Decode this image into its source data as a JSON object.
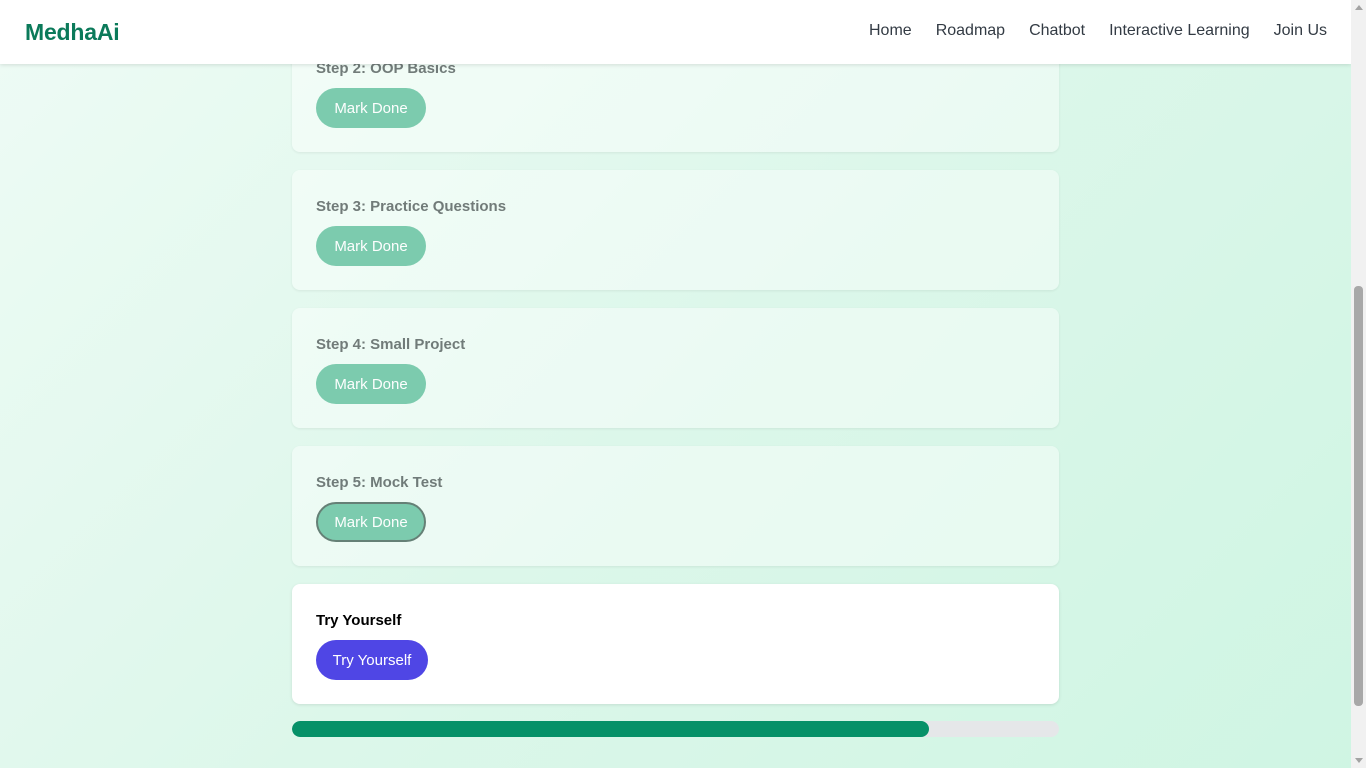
{
  "nav": {
    "brand": "MedhaAi",
    "links": [
      "Home",
      "Roadmap",
      "Chatbot",
      "Interactive Learning",
      "Join Us"
    ]
  },
  "steps": [
    {
      "title": "Step 2: OOP Basics",
      "button": "Mark Done"
    },
    {
      "title": "Step 3: Practice Questions",
      "button": "Mark Done"
    },
    {
      "title": "Step 4: Small Project",
      "button": "Mark Done"
    },
    {
      "title": "Step 5: Mock Test",
      "button": "Mark Done"
    }
  ],
  "try_section": {
    "title": "Try Yourself",
    "button": "Try Yourself"
  },
  "progress": {
    "fraction": 0.83
  },
  "colors": {
    "brand": "#0b7a5a",
    "mark_button": "#77c9ab",
    "try_button": "#4f46e5",
    "progress_fill": "#069168"
  }
}
